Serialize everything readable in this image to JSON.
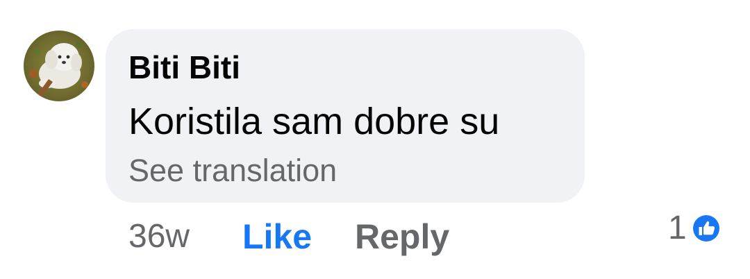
{
  "comment": {
    "author": "Biti Biti",
    "text": "Koristila sam dobre su",
    "see_translation_label": "See translation",
    "timestamp": "36w",
    "like_label": "Like",
    "reply_label": "Reply",
    "reaction_count": "1",
    "reaction_icon": "thumbs-up-icon",
    "avatar_icon": "white-dog-photo"
  },
  "colors": {
    "bubble_bg": "#f0f2f5",
    "primary_text": "#050505",
    "secondary_text": "#65676b",
    "like_blue": "#1877f2"
  }
}
